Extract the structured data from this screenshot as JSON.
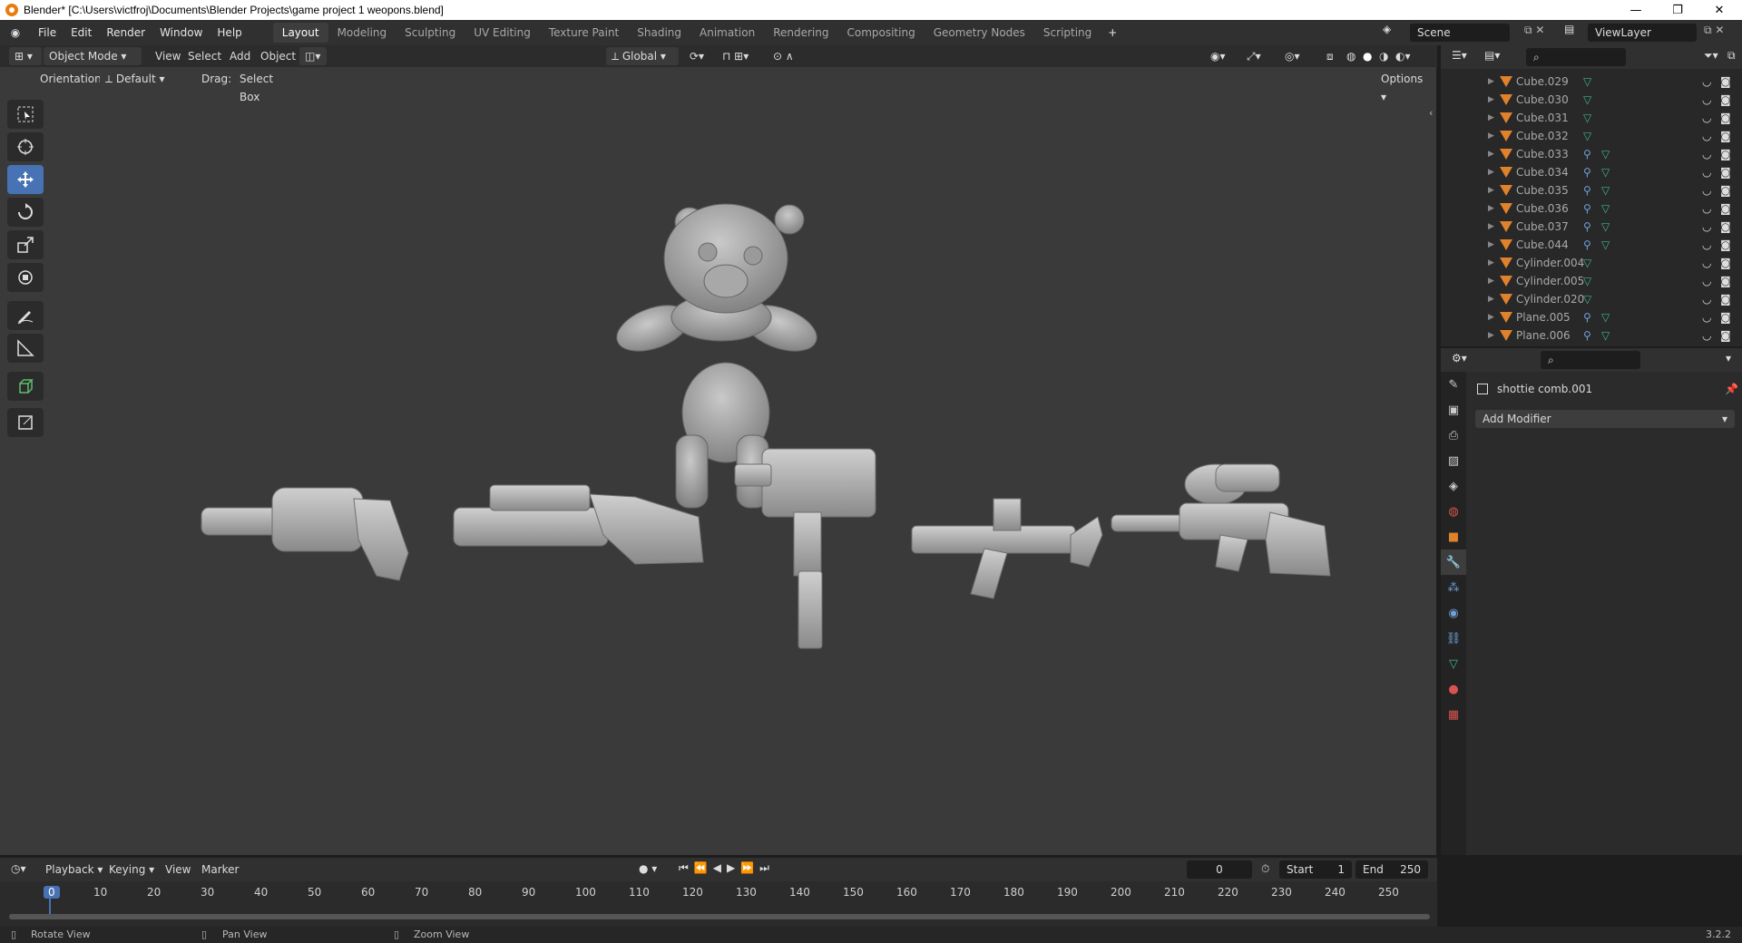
{
  "window": {
    "title": "Blender* [C:\\Users\\victfroj\\Documents\\Blender Projects\\game project 1 weopons.blend]"
  },
  "menu": [
    "File",
    "Edit",
    "Render",
    "Window",
    "Help"
  ],
  "workspaces": [
    "Layout",
    "Modeling",
    "Sculpting",
    "UV Editing",
    "Texture Paint",
    "Shading",
    "Animation",
    "Rendering",
    "Compositing",
    "Geometry Nodes",
    "Scripting"
  ],
  "active_workspace": "Layout",
  "scene": {
    "name": "Scene",
    "view_layer": "ViewLayer"
  },
  "viewport_header": {
    "mode": "Object Mode",
    "view": "View",
    "select": "Select",
    "add": "Add",
    "object": "Object",
    "transform": "Global"
  },
  "tool_settings": {
    "orientation_label": "Orientation:",
    "orientation_value": "Default",
    "drag_label": "Drag:",
    "drag_value": "Select Box",
    "options": "Options"
  },
  "outliner_items": [
    {
      "name": "Cube.029",
      "modifier": false
    },
    {
      "name": "Cube.030",
      "modifier": false
    },
    {
      "name": "Cube.031",
      "modifier": false
    },
    {
      "name": "Cube.032",
      "modifier": false
    },
    {
      "name": "Cube.033",
      "modifier": true
    },
    {
      "name": "Cube.034",
      "modifier": true
    },
    {
      "name": "Cube.035",
      "modifier": true
    },
    {
      "name": "Cube.036",
      "modifier": true
    },
    {
      "name": "Cube.037",
      "modifier": true
    },
    {
      "name": "Cube.044",
      "modifier": true
    },
    {
      "name": "Cylinder.004",
      "modifier": false
    },
    {
      "name": "Cylinder.005",
      "modifier": false
    },
    {
      "name": "Cylinder.020",
      "modifier": false
    },
    {
      "name": "Plane.005",
      "modifier": true
    },
    {
      "name": "Plane.006",
      "modifier": true
    }
  ],
  "properties": {
    "object_name": "shottie comb.001",
    "add_modifier": "Add Modifier"
  },
  "timeline": {
    "menus": [
      "Playback",
      "Keying",
      "View",
      "Marker"
    ],
    "current_frame": "0",
    "start_label": "Start",
    "start": "1",
    "end_label": "End",
    "end": "250",
    "frame_marks": [
      "0",
      "10",
      "20",
      "30",
      "40",
      "50",
      "60",
      "70",
      "80",
      "90",
      "100",
      "110",
      "120",
      "130",
      "140",
      "150",
      "160",
      "170",
      "180",
      "190",
      "200",
      "210",
      "220",
      "230",
      "240",
      "250"
    ]
  },
  "status": {
    "rotate": "Rotate View",
    "pan": "Pan View",
    "zoom": "Zoom View",
    "version": "3.2.2"
  },
  "colors": {
    "selected_tool": "#4772b3",
    "object_orange": "#e0822b",
    "mesh_green": "#3fb38e",
    "frame_blue": "#4772b3"
  }
}
